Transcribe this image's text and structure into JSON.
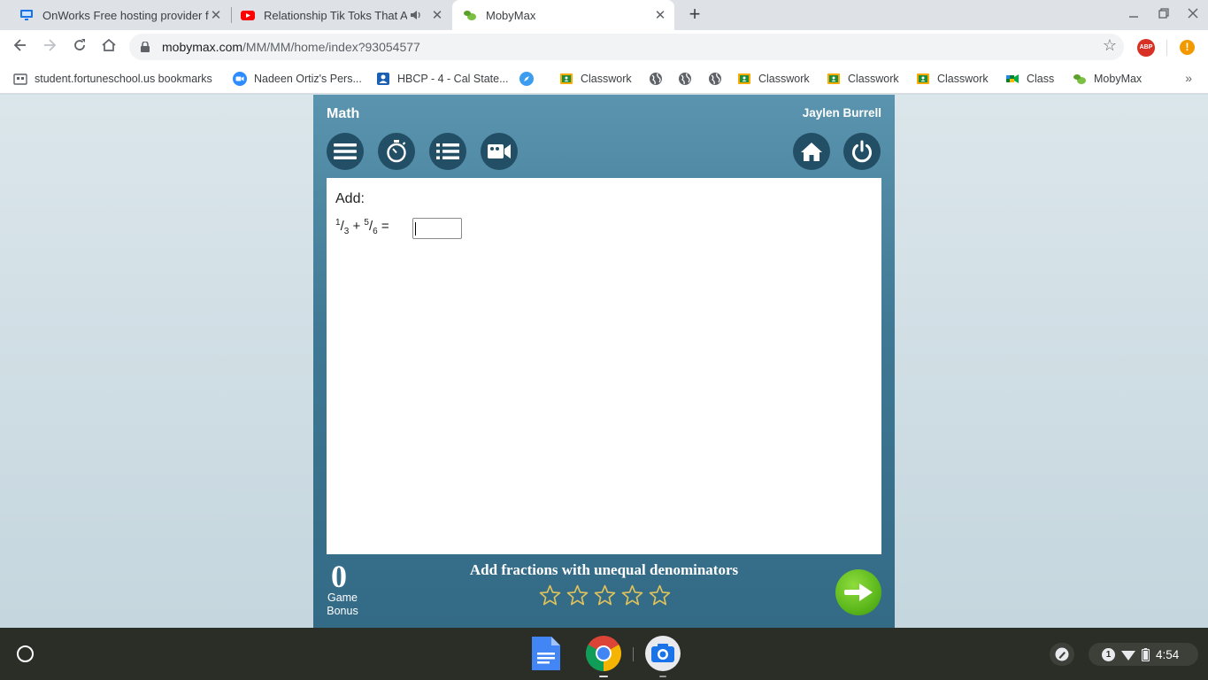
{
  "browser": {
    "tabs": [
      {
        "title": "OnWorks Free hosting provider fo",
        "active": false,
        "muted_icon": false
      },
      {
        "title": "Relationship Tik Toks That A",
        "active": false,
        "muted_icon": true
      },
      {
        "title": "MobyMax",
        "active": true,
        "muted_icon": false
      }
    ],
    "new_tab_glyph": "+",
    "url_domain": "mobymax.com",
    "url_path": "/MM/MM/home/index?93054577",
    "extension_abp": "ABP",
    "alert_glyph": "!"
  },
  "bookmarks": [
    {
      "label": "student.fortuneschool.us bookmarks",
      "icon": "apps-icon"
    },
    {
      "label": "Nadeen Ortiz's Pers...",
      "icon": "zoom-icon"
    },
    {
      "label": "HBCP - 4 - Cal State...",
      "icon": "contact-icon"
    },
    {
      "label": "",
      "icon": "safari-icon"
    },
    {
      "label": "Classwork",
      "icon": "classroom-icon"
    },
    {
      "label": "",
      "icon": "globe-icon"
    },
    {
      "label": "",
      "icon": "globe-icon"
    },
    {
      "label": "",
      "icon": "globe-icon"
    },
    {
      "label": "Classwork",
      "icon": "classroom-icon"
    },
    {
      "label": "Classwork",
      "icon": "classroom-icon"
    },
    {
      "label": "Classwork",
      "icon": "classroom-icon"
    },
    {
      "label": "Class",
      "icon": "meet-icon"
    },
    {
      "label": "MobyMax",
      "icon": "mobymax-icon"
    }
  ],
  "bookmarks_more": "»",
  "mobymax": {
    "subject": "Math",
    "student_name": "Jaylen Burrell",
    "prompt": "Add:",
    "equation": {
      "a_num": "1",
      "a_den": "3",
      "op": "+",
      "b_num": "5",
      "b_den": "6",
      "eq": "="
    },
    "answer_value": "",
    "game_bonus_value": "0",
    "game_bonus_label_1": "Game",
    "game_bonus_label_2": "Bonus",
    "skill_title": "Add fractions with unequal denominators",
    "stars_filled": 0,
    "stars_total": 5
  },
  "shelf": {
    "notification_count": "1",
    "time": "4:54"
  },
  "colors": {
    "panel_top": "#5a94ae",
    "panel_bottom": "#336a86",
    "control_button": "#234f66",
    "next_button": "#5cb81c",
    "star_outline": "#e0c25a"
  }
}
